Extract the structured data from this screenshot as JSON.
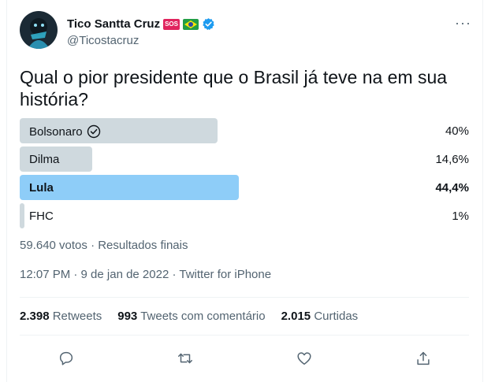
{
  "author": {
    "display_name": "Tico Santta Cruz",
    "badge_text": "SOS",
    "flag_icon": "brazil-flag-icon",
    "verified_icon": "verified-icon",
    "handle": "@Ticostacruz"
  },
  "tweet": {
    "text": "Qual o pior presidente que o Brasil já teve na em sua história?"
  },
  "poll": {
    "options": [
      {
        "label": "Bolsonaro",
        "percent_text": "40%",
        "percent": 40,
        "checked": true,
        "winner": false
      },
      {
        "label": "Dilma",
        "percent_text": "14,6%",
        "percent": 14.6,
        "checked": false,
        "winner": false
      },
      {
        "label": "Lula",
        "percent_text": "44,4%",
        "percent": 44.4,
        "checked": false,
        "winner": true
      },
      {
        "label": "FHC",
        "percent_text": "1%",
        "percent": 1,
        "checked": false,
        "winner": false
      }
    ],
    "summary": "59.640 votos · Resultados finais"
  },
  "meta": {
    "timestamp": "12:07 PM · 9 de jan de 2022 · Twitter for iPhone"
  },
  "stats": {
    "retweets_count": "2.398",
    "retweets_label": "Retweets",
    "quotes_count": "993",
    "quotes_label": "Tweets com comentário",
    "likes_count": "2.015",
    "likes_label": "Curtidas"
  },
  "colors": {
    "bar": "#cfd9de",
    "winner_bar": "#8ecdf8",
    "secondary_text": "#536471",
    "accent": "#1d9bf0"
  }
}
